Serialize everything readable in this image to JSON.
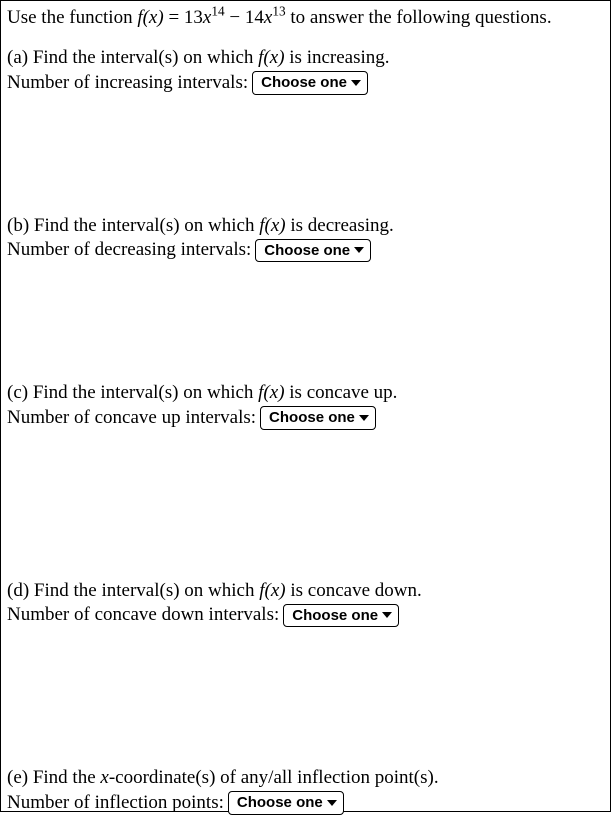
{
  "intro": {
    "prefix": "Use the function ",
    "fx": "f(x)",
    "equals": " = 13",
    "var1": "x",
    "exp1": "14",
    "minus": " − 14",
    "var2": "x",
    "exp2": "13",
    "suffix": " to answer the following questions."
  },
  "questions": {
    "a": {
      "label": "(a) Find the interval(s) on which ",
      "fx": "f(x)",
      "suffix": " is increasing.",
      "answer_label": "Number of increasing intervals:",
      "dropdown": "Choose one"
    },
    "b": {
      "label": "(b) Find the interval(s) on which ",
      "fx": "f(x)",
      "suffix": " is decreasing.",
      "answer_label": "Number of decreasing intervals:",
      "dropdown": "Choose one"
    },
    "c": {
      "label": "(c) Find the interval(s) on which ",
      "fx": "f(x)",
      "suffix": " is concave up.",
      "answer_label": "Number of concave up intervals:",
      "dropdown": "Choose one"
    },
    "d": {
      "label": "(d) Find the interval(s) on which ",
      "fx": "f(x)",
      "suffix": " is concave down.",
      "answer_label": "Number of concave down intervals:",
      "dropdown": "Choose one"
    },
    "e": {
      "label_prefix": "(e) Find the ",
      "xvar": "x",
      "label_suffix": "-coordinate(s) of any/all inflection point(s).",
      "answer_label": "Number of inflection points:",
      "dropdown": "Choose one"
    }
  }
}
